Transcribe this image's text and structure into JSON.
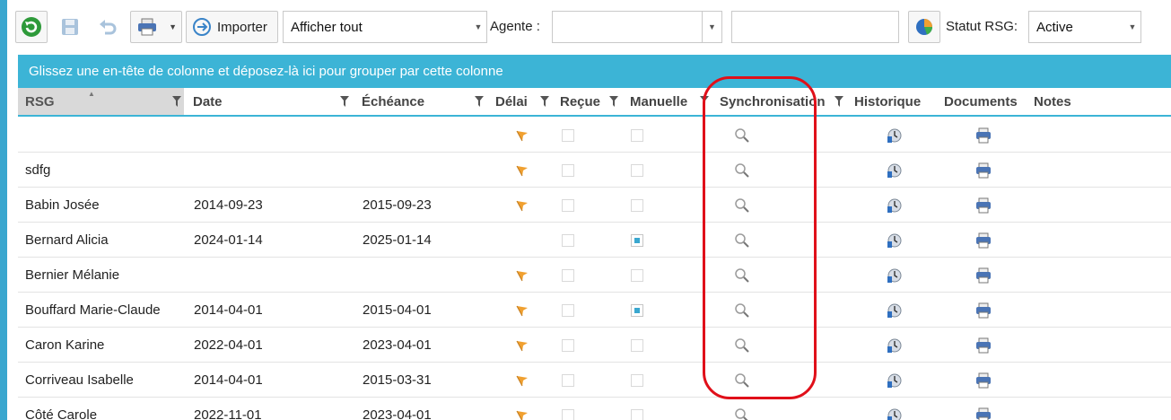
{
  "toolbar": {
    "importer_label": "Importer",
    "filter_value": "Afficher tout",
    "agente_label": "Agente :",
    "agente_value": "",
    "search_value": "",
    "statut_label": "Statut RSG:",
    "statut_value": "Active"
  },
  "group_panel_text": "Glissez une en-tête de colonne et déposez-là ici pour grouper par cette colonne",
  "columns": {
    "rsg": "RSG",
    "date": "Date",
    "echeance": "Échéance",
    "delai": "Délai",
    "recue": "Reçue",
    "manuelle": "Manuelle",
    "synchronisation": "Synchronisation",
    "historique": "Historique",
    "documents": "Documents",
    "notes": "Notes"
  },
  "rows": [
    {
      "rsg": "",
      "date": "",
      "echeance": "",
      "delai_flag": true,
      "recue": false,
      "manuelle": false
    },
    {
      "rsg": "sdfg",
      "date": "",
      "echeance": "",
      "delai_flag": true,
      "recue": false,
      "manuelle": false
    },
    {
      "rsg": "Babin Josée",
      "date": "2014-09-23",
      "echeance": "2015-09-23",
      "delai_flag": true,
      "recue": false,
      "manuelle": false
    },
    {
      "rsg": "Bernard Alicia",
      "date": "2024-01-14",
      "echeance": "2025-01-14",
      "delai_flag": false,
      "recue": false,
      "manuelle": true
    },
    {
      "rsg": "Bernier Mélanie",
      "date": "",
      "echeance": "",
      "delai_flag": true,
      "recue": false,
      "manuelle": false
    },
    {
      "rsg": "Bouffard Marie-Claude",
      "date": "2014-04-01",
      "echeance": "2015-04-01",
      "delai_flag": true,
      "recue": false,
      "manuelle": true
    },
    {
      "rsg": "Caron Karine",
      "date": "2022-04-01",
      "echeance": "2023-04-01",
      "delai_flag": true,
      "recue": false,
      "manuelle": false
    },
    {
      "rsg": "Corriveau Isabelle",
      "date": "2014-04-01",
      "echeance": "2015-03-31",
      "delai_flag": true,
      "recue": false,
      "manuelle": false
    },
    {
      "rsg": "Côté Carole",
      "date": "2022-11-01",
      "echeance": "2023-04-01",
      "delai_flag": true,
      "recue": false,
      "manuelle": false
    }
  ],
  "icons": {
    "refresh": "refresh-icon",
    "save": "save-icon",
    "undo": "undo-icon",
    "print": "print-icon",
    "importer": "import-icon",
    "stats": "pie-chart-icon",
    "delai": "flag-icon",
    "synchronisation": "magnifier-icon",
    "historique": "history-icon",
    "documents": "printer-icon"
  },
  "colors": {
    "accent": "#3cb4d6",
    "flag": "#f0a030",
    "annotation": "#e0101a"
  }
}
